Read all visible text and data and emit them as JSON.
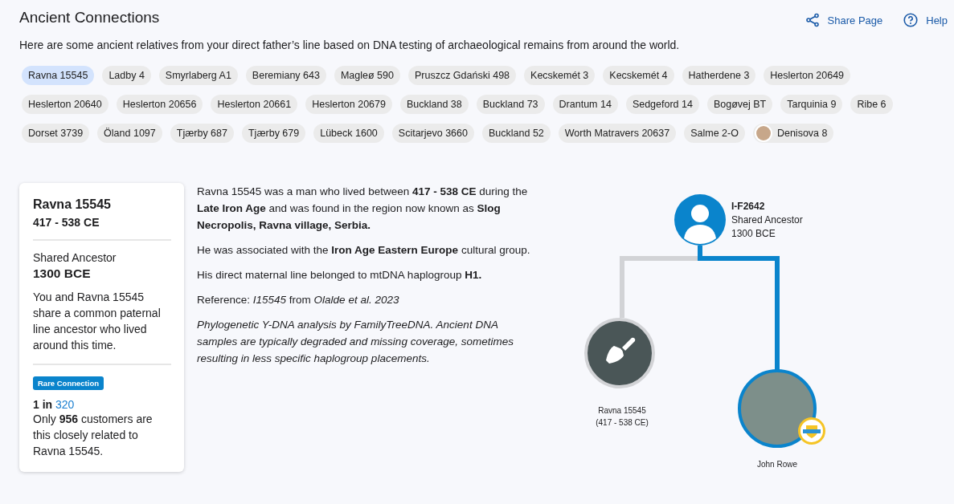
{
  "header": {
    "title": "Ancient Connections",
    "actions": [
      {
        "kind": "share",
        "label": "Share Page"
      },
      {
        "kind": "help",
        "label": "Help"
      }
    ]
  },
  "intro": "Here are some ancient relatives from your direct father’s line based on DNA testing of archaeological remains from around the world.",
  "samples": [
    {
      "label": "Ravna 15545",
      "selected": true,
      "kind": "text"
    },
    {
      "label": "Ladby 4",
      "selected": false,
      "kind": "text"
    },
    {
      "label": "Smyrlaberg A1",
      "selected": false,
      "kind": "text"
    },
    {
      "label": "Beremiany 643",
      "selected": false,
      "kind": "text"
    },
    {
      "label": "Magleø 590",
      "selected": false,
      "kind": "text"
    },
    {
      "label": "Pruszcz Gdański 498",
      "selected": false,
      "kind": "text"
    },
    {
      "label": "Kecskemét 3",
      "selected": false,
      "kind": "text"
    },
    {
      "label": "Kecskemét 4",
      "selected": false,
      "kind": "text"
    },
    {
      "label": "Hatherdene 3",
      "selected": false,
      "kind": "text"
    },
    {
      "label": "Heslerton 20649",
      "selected": false,
      "kind": "text"
    },
    {
      "label": "Heslerton 20640",
      "selected": false,
      "kind": "text"
    },
    {
      "label": "Heslerton 20656",
      "selected": false,
      "kind": "text"
    },
    {
      "label": "Heslerton 20661",
      "selected": false,
      "kind": "text"
    },
    {
      "label": "Heslerton 20679",
      "selected": false,
      "kind": "text"
    },
    {
      "label": "Buckland 38",
      "selected": false,
      "kind": "text"
    },
    {
      "label": "Buckland 73",
      "selected": false,
      "kind": "text"
    },
    {
      "label": "Drantum 14",
      "selected": false,
      "kind": "text"
    },
    {
      "label": "Sedgeford 14",
      "selected": false,
      "kind": "text"
    },
    {
      "label": "Bogøvej BT",
      "selected": false,
      "kind": "text"
    },
    {
      "label": "Tarquinia 9",
      "selected": false,
      "kind": "text"
    },
    {
      "label": "Ribe 6",
      "selected": false,
      "kind": "text"
    },
    {
      "label": "Dorset 3739",
      "selected": false,
      "kind": "text"
    },
    {
      "label": "Öland 1097",
      "selected": false,
      "kind": "text"
    },
    {
      "label": "Tjærby 687",
      "selected": false,
      "kind": "text"
    },
    {
      "label": "Tjærby 679",
      "selected": false,
      "kind": "text"
    },
    {
      "label": "Lübeck 1600",
      "selected": false,
      "kind": "text"
    },
    {
      "label": "Scitarjevo 3660",
      "selected": false,
      "kind": "text"
    },
    {
      "label": "Buckland 52",
      "selected": false,
      "kind": "text"
    },
    {
      "label": "Worth Matravers 20637",
      "selected": false,
      "kind": "text"
    },
    {
      "label": "Salme 2-O",
      "selected": false,
      "kind": "text"
    },
    {
      "label": "Denisova 8",
      "selected": false,
      "kind": "image"
    }
  ],
  "summary_card": {
    "name": "Ravna 15545",
    "dates": "417 - 538 CE",
    "ancestor_label": "Shared Ancestor",
    "ancestor_date": "1300 BCE",
    "description": "You and Ravna 15545 share a common paternal line ancestor who lived around this time.",
    "badge": "Rare Connection",
    "rarity_prefix": "1 in",
    "rarity_value": "320",
    "rarity_text": "Only **956** customers are this closely related to Ravna 15545."
  },
  "details": [
    {
      "kind": "normal",
      "text": "Ravna 15545 was a man who lived between **417 - 538 CE** during the **Late Iron Age** and was found in the region now known as **Slog Necropolis, Ravna village, Serbia.**"
    },
    {
      "kind": "normal",
      "text": "He was associated with the **Iron Age Eastern Europe** cultural group."
    },
    {
      "kind": "normal",
      "text": "His direct maternal line belonged to mtDNA haplogroup **H1.**"
    },
    {
      "kind": "normal",
      "text": "Reference: *I15545* from *Olalde et al. 2023*"
    },
    {
      "kind": "note",
      "text": "Phylogenetic Y-DNA analysis by FamilyTreeDNA. Ancient DNA samples are typically degraded and missing coverage, sometimes resulting in less specific haplogroup placements."
    }
  ],
  "tree": {
    "ancestor": {
      "haplogroup": "I-F2642",
      "label": "Shared Ancestor",
      "date": "1300 BCE"
    },
    "ancient": {
      "name": "Ravna 15545",
      "dates": "(417 - 538 CE)"
    },
    "user": {
      "name": "John Rowe"
    }
  }
}
